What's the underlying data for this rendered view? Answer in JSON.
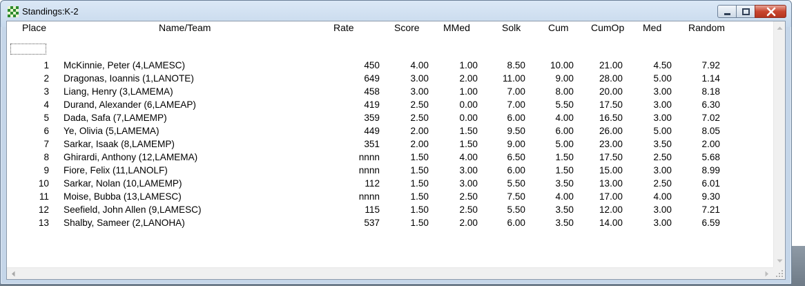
{
  "window": {
    "title": "Standings:K-2"
  },
  "columns": [
    "Place",
    "Name/Team",
    "Rate",
    "Score",
    "MMed",
    "Solk",
    "Cum",
    "CumOp",
    "Med",
    "Random"
  ],
  "rows": [
    {
      "place": "1",
      "name": "McKinnie, Peter (4,LAMESC)",
      "rate": "450",
      "score": "4.00",
      "mmed": "1.00",
      "solk": "8.50",
      "cum": "10.00",
      "cumop": "21.00",
      "med": "4.50",
      "random": "7.92"
    },
    {
      "place": "2",
      "name": "Dragonas, Ioannis (1,LANOTE)",
      "rate": "649",
      "score": "3.00",
      "mmed": "2.00",
      "solk": "11.00",
      "cum": "9.00",
      "cumop": "28.00",
      "med": "5.00",
      "random": "1.14"
    },
    {
      "place": "3",
      "name": "Liang, Henry (3,LAMEMA)",
      "rate": "458",
      "score": "3.00",
      "mmed": "1.00",
      "solk": "7.00",
      "cum": "8.00",
      "cumop": "20.00",
      "med": "3.00",
      "random": "8.18"
    },
    {
      "place": "4",
      "name": "Durand, Alexander (6,LAMEAP)",
      "rate": "419",
      "score": "2.50",
      "mmed": "0.00",
      "solk": "7.00",
      "cum": "5.50",
      "cumop": "17.50",
      "med": "3.00",
      "random": "6.30"
    },
    {
      "place": "5",
      "name": "Dada, Safa (7,LAMEMP)",
      "rate": "359",
      "score": "2.50",
      "mmed": "0.00",
      "solk": "6.00",
      "cum": "4.00",
      "cumop": "16.50",
      "med": "3.00",
      "random": "7.02"
    },
    {
      "place": "6",
      "name": "Ye, Olivia (5,LAMEMA)",
      "rate": "449",
      "score": "2.00",
      "mmed": "1.50",
      "solk": "9.50",
      "cum": "6.00",
      "cumop": "26.00",
      "med": "5.00",
      "random": "8.05"
    },
    {
      "place": "7",
      "name": "Sarkar, Isaak (8,LAMEMP)",
      "rate": "351",
      "score": "2.00",
      "mmed": "1.50",
      "solk": "9.00",
      "cum": "5.00",
      "cumop": "23.00",
      "med": "3.50",
      "random": "2.00"
    },
    {
      "place": "8",
      "name": "Ghirardi, Anthony (12,LAMEMA)",
      "rate": "nnnn",
      "score": "1.50",
      "mmed": "4.00",
      "solk": "6.50",
      "cum": "1.50",
      "cumop": "17.50",
      "med": "2.50",
      "random": "5.68"
    },
    {
      "place": "9",
      "name": "Fiore, Felix (11,LANOLF)",
      "rate": "nnnn",
      "score": "1.50",
      "mmed": "3.00",
      "solk": "6.00",
      "cum": "1.50",
      "cumop": "15.00",
      "med": "3.00",
      "random": "8.99"
    },
    {
      "place": "10",
      "name": "Sarkar, Nolan (10,LAMEMP)",
      "rate": "112",
      "score": "1.50",
      "mmed": "3.00",
      "solk": "5.50",
      "cum": "3.50",
      "cumop": "13.00",
      "med": "2.50",
      "random": "6.01"
    },
    {
      "place": "11",
      "name": "Moise, Bubba (13,LAMESC)",
      "rate": "nnnn",
      "score": "1.50",
      "mmed": "2.50",
      "solk": "7.50",
      "cum": "4.00",
      "cumop": "17.00",
      "med": "4.00",
      "random": "9.30"
    },
    {
      "place": "12",
      "name": "Seefield, John Allen (9,LAMESC)",
      "rate": "115",
      "score": "1.50",
      "mmed": "2.50",
      "solk": "5.50",
      "cum": "3.50",
      "cumop": "12.00",
      "med": "3.00",
      "random": "7.21"
    },
    {
      "place": "13",
      "name": "Shalby, Sameer (2,LANOHA)",
      "rate": "537",
      "score": "1.50",
      "mmed": "2.00",
      "solk": "6.00",
      "cum": "3.50",
      "cumop": "14.00",
      "med": "3.00",
      "random": "6.59"
    }
  ],
  "colors": {
    "titlebar": "#c7d9ec",
    "close_button": "#c8452f"
  },
  "icons": {
    "app": "chessboard-icon",
    "minimize": "minimize-icon",
    "maximize": "maximize-icon",
    "close": "close-icon"
  }
}
